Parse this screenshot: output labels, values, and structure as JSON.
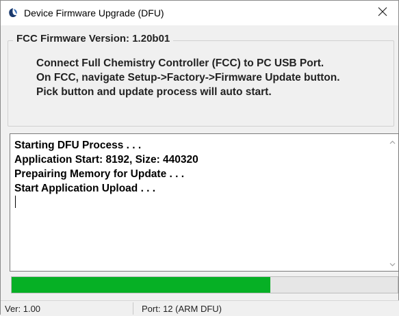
{
  "window": {
    "title": "Device Firmware Upgrade (DFU)",
    "icon": "app-logo-icon",
    "close_icon": "close-icon"
  },
  "group": {
    "legend": "FCC Firmware Version: 1.20b01",
    "lines": [
      "Connect Full Chemistry Controller (FCC) to PC USB Port.",
      "On FCC, navigate Setup->Factory->Firmware Update button.",
      "Pick button and update process will auto start."
    ]
  },
  "log": {
    "lines": [
      "Starting DFU Process . . .",
      "Application Start: 8192, Size: 440320",
      "Prepairing Memory for Update . . .",
      "Start Application Upload . . ."
    ]
  },
  "progress": {
    "fraction": 0.67,
    "color": "#06b025"
  },
  "status": {
    "version": "Ver: 1.00",
    "port": "Port: 12 (ARM DFU)"
  }
}
